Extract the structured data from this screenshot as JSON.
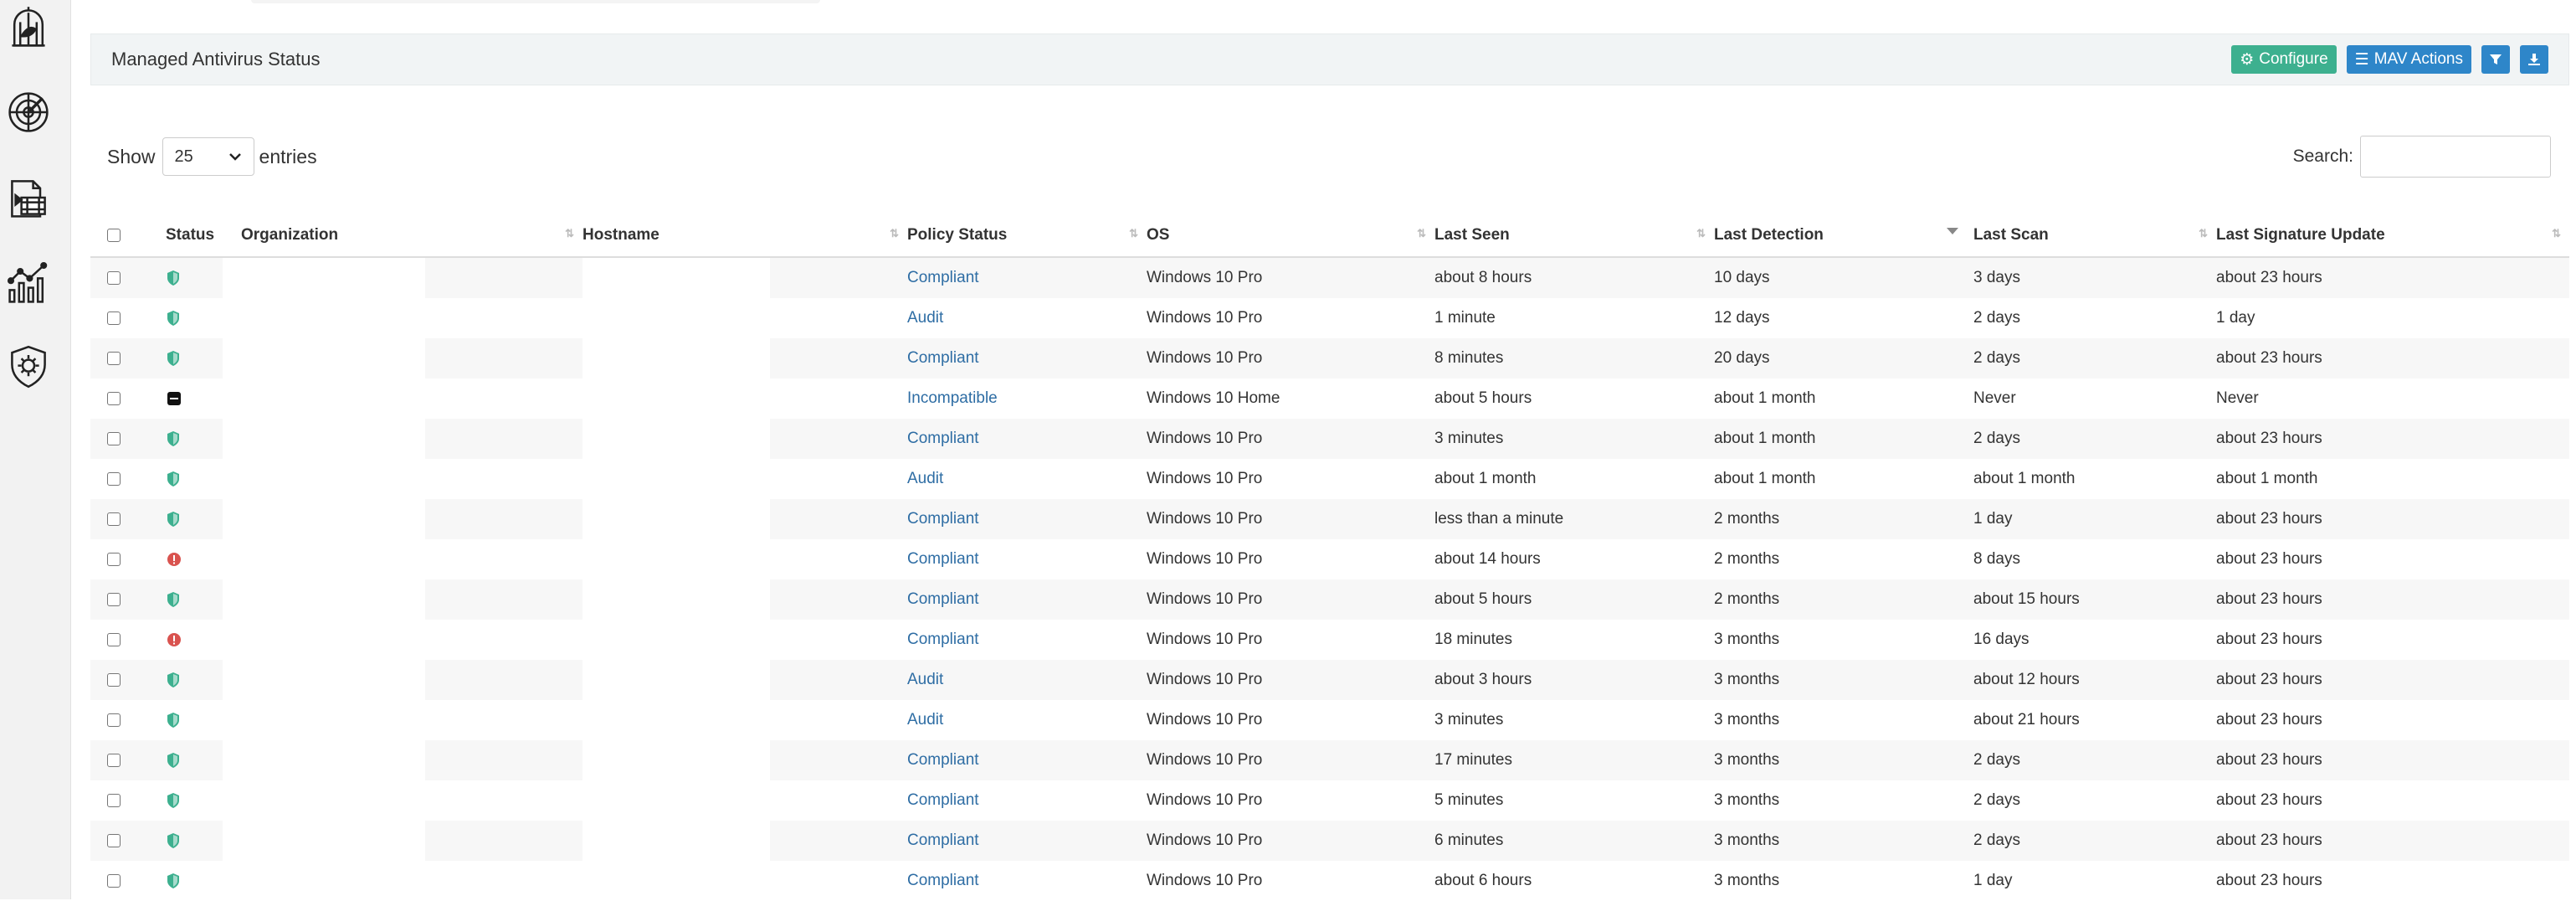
{
  "sidebar": {
    "items": [
      {
        "icon": "birdcage-icon"
      },
      {
        "icon": "radar-icon"
      },
      {
        "icon": "media-files-icon"
      },
      {
        "icon": "analytics-chart-icon"
      },
      {
        "icon": "shield-gear-icon"
      }
    ]
  },
  "panel": {
    "title": "Managed Antivirus Status",
    "buttons": {
      "configure": "Configure",
      "mav_actions": "MAV Actions"
    }
  },
  "controls": {
    "show_label": "Show",
    "entries_label": "entries",
    "page_size": "25",
    "search_label": "Search:",
    "search_value": ""
  },
  "table": {
    "columns": [
      "Status",
      "Organization",
      "Hostname",
      "Policy Status",
      "OS",
      "Last Seen",
      "Last Detection",
      "Last Scan",
      "Last Signature Update"
    ],
    "rows": [
      {
        "status": "protected",
        "policy": "Compliant",
        "os": "Windows 10 Pro",
        "seen": "about 8 hours",
        "detection": "10 days",
        "scan": "3 days",
        "sig": "about 23 hours"
      },
      {
        "status": "protected",
        "policy": "Audit",
        "os": "Windows 10 Pro",
        "seen": "1 minute",
        "detection": "12 days",
        "scan": "2 days",
        "sig": "1 day"
      },
      {
        "status": "protected",
        "policy": "Compliant",
        "os": "Windows 10 Pro",
        "seen": "8 minutes",
        "detection": "20 days",
        "scan": "2 days",
        "sig": "about 23 hours"
      },
      {
        "status": "incompatible",
        "policy": "Incompatible",
        "os": "Windows 10 Home",
        "seen": "about 5 hours",
        "detection": "about 1 month",
        "scan": "Never",
        "sig": "Never"
      },
      {
        "status": "protected",
        "policy": "Compliant",
        "os": "Windows 10 Pro",
        "seen": "3 minutes",
        "detection": "about 1 month",
        "scan": "2 days",
        "sig": "about 23 hours"
      },
      {
        "status": "protected",
        "policy": "Audit",
        "os": "Windows 10 Pro",
        "seen": "about 1 month",
        "detection": "about 1 month",
        "scan": "about 1 month",
        "sig": "about 1 month"
      },
      {
        "status": "protected",
        "policy": "Compliant",
        "os": "Windows 10 Pro",
        "seen": "less than a minute",
        "detection": "2 months",
        "scan": "1 day",
        "sig": "about 23 hours"
      },
      {
        "status": "alert",
        "policy": "Compliant",
        "os": "Windows 10 Pro",
        "seen": "about 14 hours",
        "detection": "2 months",
        "scan": "8 days",
        "sig": "about 23 hours"
      },
      {
        "status": "protected",
        "policy": "Compliant",
        "os": "Windows 10 Pro",
        "seen": "about 5 hours",
        "detection": "2 months",
        "scan": "about 15 hours",
        "sig": "about 23 hours"
      },
      {
        "status": "alert",
        "policy": "Compliant",
        "os": "Windows 10 Pro",
        "seen": "18 minutes",
        "detection": "3 months",
        "scan": "16 days",
        "sig": "about 23 hours"
      },
      {
        "status": "protected",
        "policy": "Audit",
        "os": "Windows 10 Pro",
        "seen": "about 3 hours",
        "detection": "3 months",
        "scan": "about 12 hours",
        "sig": "about 23 hours"
      },
      {
        "status": "protected",
        "policy": "Audit",
        "os": "Windows 10 Pro",
        "seen": "3 minutes",
        "detection": "3 months",
        "scan": "about 21 hours",
        "sig": "about 23 hours"
      },
      {
        "status": "protected",
        "policy": "Compliant",
        "os": "Windows 10 Pro",
        "seen": "17 minutes",
        "detection": "3 months",
        "scan": "2 days",
        "sig": "about 23 hours"
      },
      {
        "status": "protected",
        "policy": "Compliant",
        "os": "Windows 10 Pro",
        "seen": "5 minutes",
        "detection": "3 months",
        "scan": "2 days",
        "sig": "about 23 hours"
      },
      {
        "status": "protected",
        "policy": "Compliant",
        "os": "Windows 10 Pro",
        "seen": "6 minutes",
        "detection": "3 months",
        "scan": "2 days",
        "sig": "about 23 hours"
      },
      {
        "status": "protected",
        "policy": "Compliant",
        "os": "Windows 10 Pro",
        "seen": "about 6 hours",
        "detection": "3 months",
        "scan": "1 day",
        "sig": "about 23 hours"
      }
    ]
  },
  "colors": {
    "shield_green": "#3db08f",
    "alert_red": "#d9534f",
    "link_blue": "#2e6da4",
    "button_green": "#3db08f",
    "button_blue": "#2e86c9"
  }
}
